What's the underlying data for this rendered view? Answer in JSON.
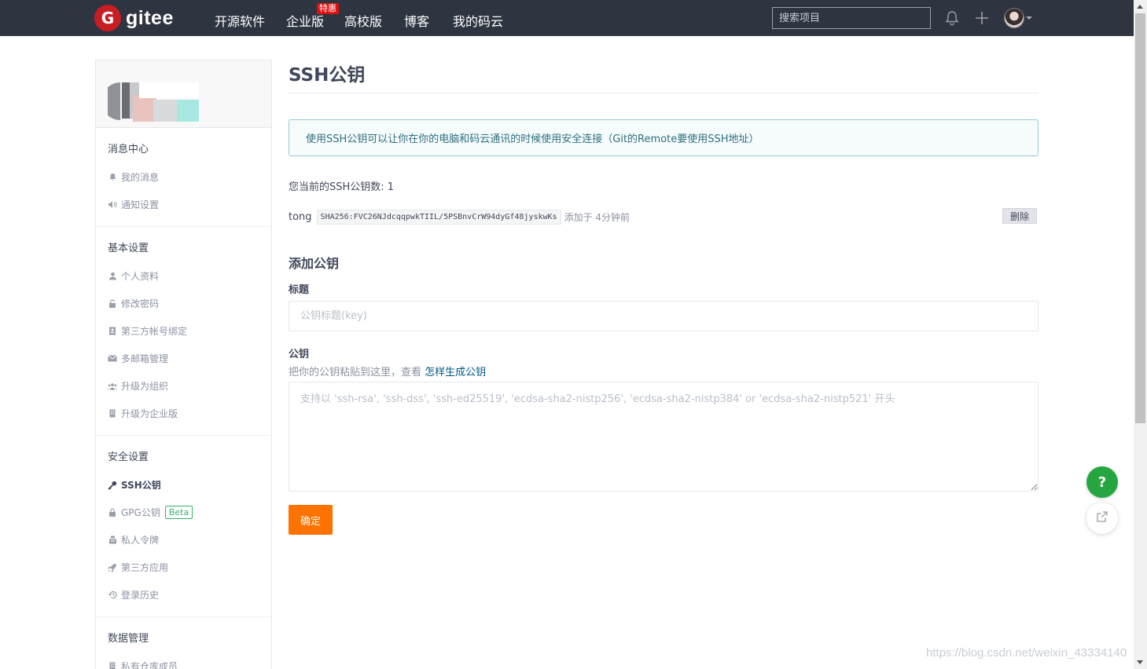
{
  "navbar": {
    "logo_text": "gitee",
    "logo_letter": "G",
    "links": [
      "开源软件",
      "企业版",
      "高校版",
      "博客",
      "我的码云"
    ],
    "enterprise_badge": "特惠",
    "search_placeholder": "搜索项目",
    "icons": [
      "bell-icon",
      "plus-icon",
      "user-avatar",
      "chevron-down-icon"
    ]
  },
  "sidebar": {
    "sections": [
      {
        "title": "消息中心",
        "items": [
          {
            "label": "我的消息",
            "icon": "bell-icon"
          },
          {
            "label": "通知设置",
            "icon": "speaker-icon"
          }
        ]
      },
      {
        "title": "基本设置",
        "items": [
          {
            "label": "个人资料",
            "icon": "user-icon"
          },
          {
            "label": "修改密码",
            "icon": "lock-icon"
          },
          {
            "label": "第三方帐号绑定",
            "icon": "id-card-icon"
          },
          {
            "label": "多邮箱管理",
            "icon": "mail-icon"
          },
          {
            "label": "升级为组织",
            "icon": "group-icon"
          },
          {
            "label": "升级为企业版",
            "icon": "building-icon"
          }
        ]
      },
      {
        "title": "安全设置",
        "items": [
          {
            "label": "SSH公钥",
            "icon": "key-icon",
            "active": true
          },
          {
            "label": "GPG公钥",
            "icon": "lock-icon",
            "badge": "Beta"
          },
          {
            "label": "私人令牌",
            "icon": "token-icon"
          },
          {
            "label": "第三方应用",
            "icon": "rocket-icon"
          },
          {
            "label": "登录历史",
            "icon": "history-icon"
          }
        ]
      },
      {
        "title": "数据管理",
        "items": [
          {
            "label": "私有仓库成员",
            "icon": "building-icon"
          }
        ]
      }
    ]
  },
  "main": {
    "title": "SSH公钥",
    "info": "使用SSH公钥可以让你在你的电脑和码云通讯的时候使用安全连接（Git的Remote要使用SSH地址）",
    "key_count_label": "您当前的SSH公钥数: 1",
    "keys": [
      {
        "name": "tong",
        "fingerprint": "SHA256:FVC26NJdcqqpwkTIIL/5PSBnvCrW94dyGf48jyskwKs",
        "added": "添加于 4分钟前",
        "delete_label": "删除"
      }
    ],
    "add_section_title": "添加公钥",
    "title_field_label": "标题",
    "title_field_placeholder": "公钥标题(key)",
    "key_field_label": "公钥",
    "key_field_hint": "把你的公钥粘贴到这里，查看 ",
    "key_field_hint_link": "怎样生成公钥",
    "key_field_placeholder": "支持以 'ssh-rsa', 'ssh-dss', 'ssh-ed25519', 'ecdsa-sha2-nistp256', 'ecdsa-sha2-nistp384' or 'ecdsa-sha2-nistp521' 开头",
    "submit_label": "确定"
  },
  "floating": {
    "help_label": "?",
    "share_icon": "external-link-icon"
  },
  "watermark": "https://blog.csdn.net/weixin_43334140",
  "colors": {
    "navbar_bg": "#2e3440",
    "brand_red": "#c71d23",
    "submit_orange": "#fe7300",
    "help_green": "#26a641",
    "info_border": "#93ccd5"
  }
}
